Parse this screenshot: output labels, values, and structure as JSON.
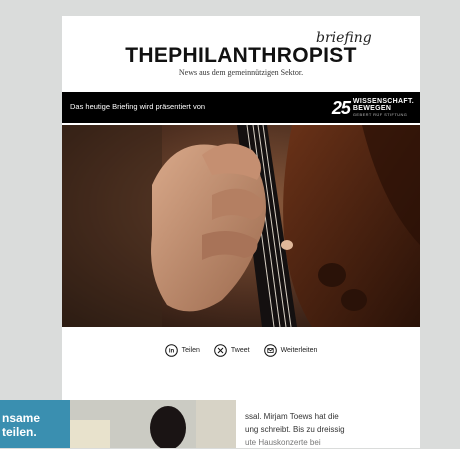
{
  "masthead": {
    "briefing_label": "briefing",
    "brand": "THEPHILANTHROPIST",
    "tagline": "News aus dem gemeinnützigen Sektor."
  },
  "sponsor": {
    "text": "Das heutige Briefing wird präsentiert von",
    "logo_number": "25",
    "logo_line1": "WISSENSCHAFT.",
    "logo_line2": "BEWEGEN",
    "logo_line3": "GEBERT RÜF STIFTUNG"
  },
  "hero": {
    "icon": "violin-photo"
  },
  "share": {
    "linkedin_label": "Teilen",
    "tweet_label": "Tweet",
    "forward_label": "Weiterleiten"
  },
  "overlay": {
    "image_text_1": "nsame",
    "image_text_2": "teilen.",
    "line1": "ssal. Mirjam Toews hat die",
    "line2": "ung schreibt. Bis zu dreissig",
    "line3": "ute Hauskonzerte bei"
  },
  "colors": {
    "page_bg": "#dadcdb",
    "card_bg": "#ffffff",
    "sponsor_bg": "#000000"
  }
}
